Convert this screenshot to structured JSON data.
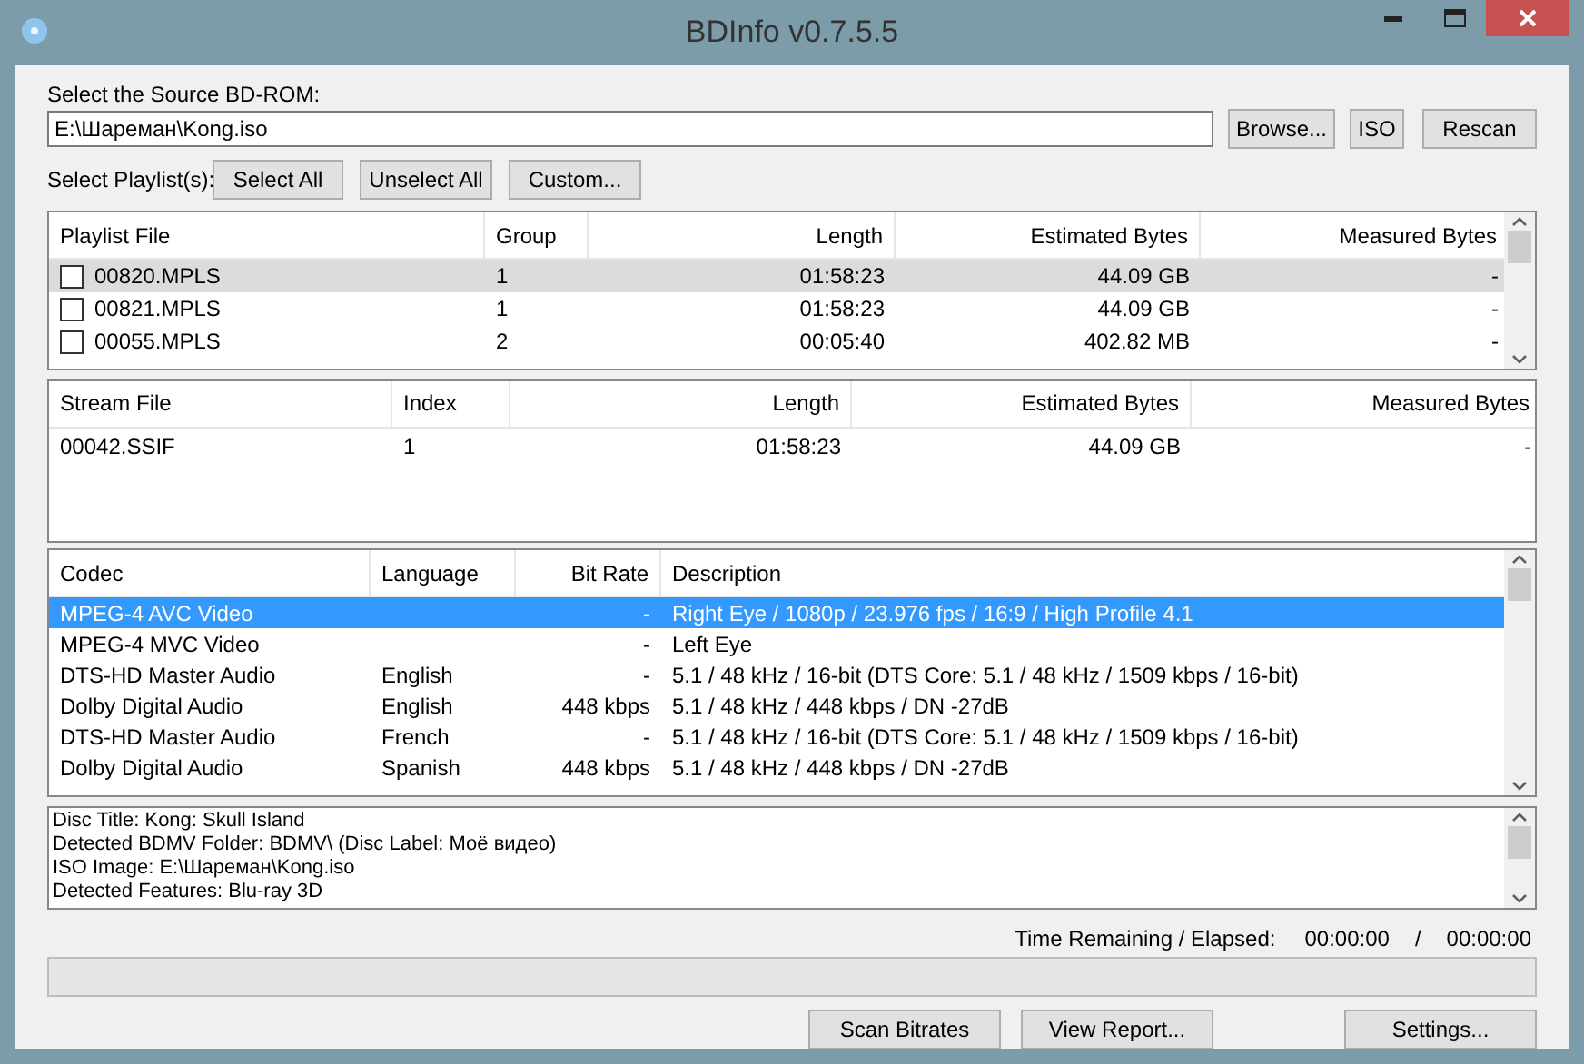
{
  "window": {
    "title": "BDInfo v0.7.5.5"
  },
  "source": {
    "label": "Select the Source BD-ROM:",
    "value": "E:\\Шареман\\Kong.iso",
    "buttons": [
      "Browse...",
      "ISO",
      "Rescan"
    ]
  },
  "playlist_select": {
    "label": "Select Playlist(s):",
    "buttons": [
      "Select All",
      "Unselect All",
      "Custom..."
    ]
  },
  "playlists": {
    "columns": [
      "Playlist File",
      "Group",
      "Length",
      "Estimated Bytes",
      "Measured Bytes"
    ],
    "rows": [
      {
        "file": "00820.MPLS",
        "group": "1",
        "length": "01:58:23",
        "estimated": "44.09 GB",
        "measured": "-",
        "checked": false,
        "selected": true
      },
      {
        "file": "00821.MPLS",
        "group": "1",
        "length": "01:58:23",
        "estimated": "44.09 GB",
        "measured": "-",
        "checked": false,
        "selected": false
      },
      {
        "file": "00055.MPLS",
        "group": "2",
        "length": "00:05:40",
        "estimated": "402.82 MB",
        "measured": "-",
        "checked": false,
        "selected": false
      }
    ]
  },
  "streams": {
    "columns": [
      "Stream File",
      "Index",
      "Length",
      "Estimated Bytes",
      "Measured Bytes"
    ],
    "rows": [
      {
        "file": "00042.SSIF",
        "index": "1",
        "length": "01:58:23",
        "estimated": "44.09 GB",
        "measured": "-"
      }
    ]
  },
  "codecs": {
    "columns": [
      "Codec",
      "Language",
      "Bit Rate",
      "Description"
    ],
    "rows": [
      {
        "codec": "MPEG-4 AVC Video",
        "language": "",
        "bitrate": "-",
        "description": "Right Eye / 1080p / 23.976 fps / 16:9 / High Profile 4.1",
        "selected": true
      },
      {
        "codec": "MPEG-4 MVC Video",
        "language": "",
        "bitrate": "-",
        "description": "Left Eye",
        "selected": false
      },
      {
        "codec": "DTS-HD Master Audio",
        "language": "English",
        "bitrate": "-",
        "description": "5.1 / 48 kHz / 16-bit (DTS Core: 5.1 / 48 kHz /  1509 kbps / 16-bit)",
        "selected": false
      },
      {
        "codec": "Dolby Digital Audio",
        "language": "English",
        "bitrate": "448 kbps",
        "description": "5.1 / 48 kHz /   448 kbps / DN -27dB",
        "selected": false
      },
      {
        "codec": "DTS-HD Master Audio",
        "language": "French",
        "bitrate": "-",
        "description": "5.1 / 48 kHz / 16-bit (DTS Core: 5.1 / 48 kHz /  1509 kbps / 16-bit)",
        "selected": false
      },
      {
        "codec": "Dolby Digital Audio",
        "language": "Spanish",
        "bitrate": "448 kbps",
        "description": "5.1 / 48 kHz /   448 kbps / DN -27dB",
        "selected": false
      }
    ]
  },
  "log": [
    "Disc Title: Kong: Skull Island",
    "Detected BDMV Folder: BDMV\\ (Disc Label: Моё видео)",
    "ISO Image: E:\\Шареман\\Kong.iso",
    "Detected Features: Blu-ray 3D"
  ],
  "time": {
    "label": "Time Remaining / Elapsed:",
    "remaining": "00:00:00",
    "separator": "/",
    "elapsed": "00:00:00"
  },
  "progress": {
    "level": 0
  },
  "bottom_buttons": [
    "Scan Bitrates",
    "View Report...",
    "Settings..."
  ]
}
